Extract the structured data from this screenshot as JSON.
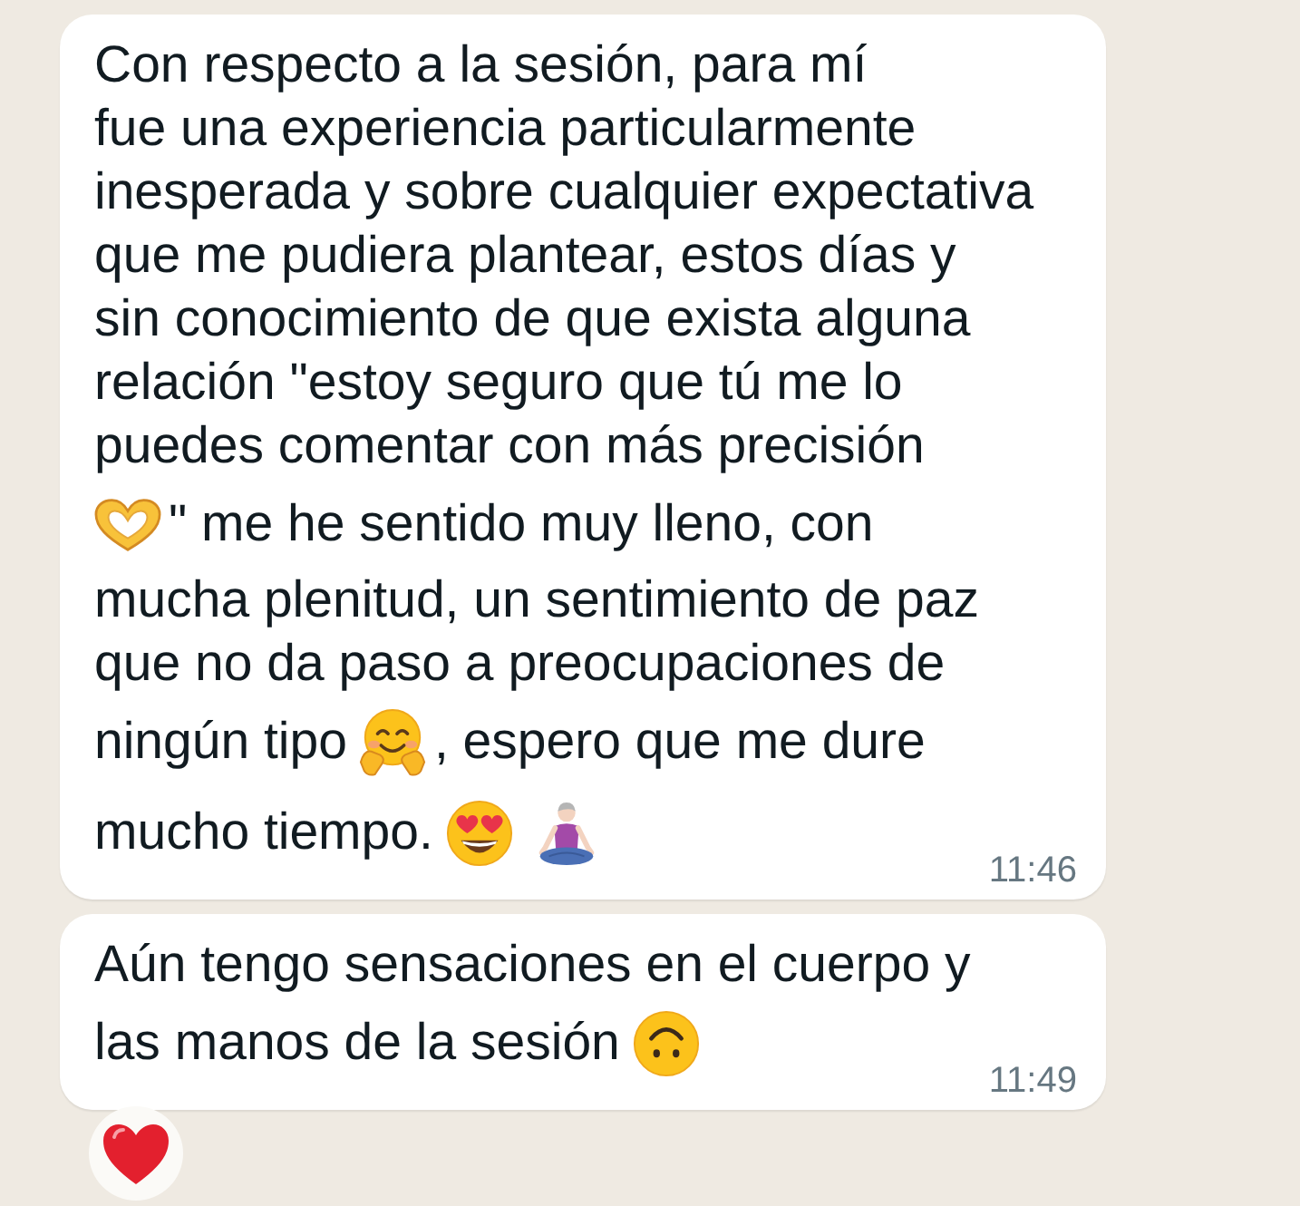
{
  "messages": [
    {
      "lines": [
        [
          {
            "kind": "text",
            "text": "Con respecto a la sesión, para mí"
          }
        ],
        [
          {
            "kind": "text",
            "text": "fue una experiencia particularmente"
          }
        ],
        [
          {
            "kind": "text",
            "text": "inesperada y sobre cualquier expectativa"
          }
        ],
        [
          {
            "kind": "text",
            "text": "que me pudiera plantear, estos días y"
          }
        ],
        [
          {
            "kind": "text",
            "text": "sin conocimiento de que exista alguna"
          }
        ],
        [
          {
            "kind": "text",
            "text": "relación \"estoy seguro que tú me lo"
          }
        ],
        [
          {
            "kind": "text",
            "text": "puedes comentar con más precisión"
          }
        ],
        [
          {
            "kind": "emoji"
          },
          {
            "kind": "text",
            "text": "\" me he sentido muy lleno, con"
          }
        ],
        [
          {
            "kind": "text",
            "text": "mucha plenitud, un sentimiento de paz"
          }
        ],
        [
          {
            "kind": "text",
            "text": "que no da paso a preocupaciones de"
          }
        ],
        [
          {
            "kind": "text",
            "text": "ningún tipo"
          },
          {
            "kind": "emoji"
          },
          {
            "kind": "text",
            "text": ", espero que me dure"
          }
        ],
        [
          {
            "kind": "text",
            "text": "mucho tiempo."
          },
          {
            "kind": "emoji"
          },
          {
            "kind": "emoji"
          }
        ]
      ],
      "time": "11:46"
    },
    {
      "lines": [
        [
          {
            "kind": "text",
            "text": "Aún tengo sensaciones en el cuerpo y"
          }
        ],
        [
          {
            "kind": "text",
            "text": "las manos de la sesión"
          },
          {
            "kind": "emoji"
          }
        ]
      ],
      "time": "11:49",
      "reaction": true
    }
  ]
}
